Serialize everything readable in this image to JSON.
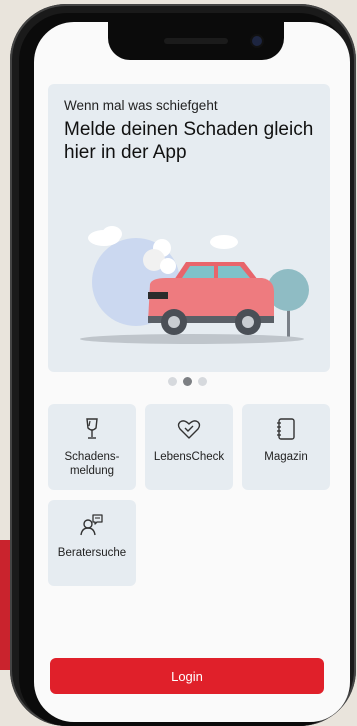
{
  "hero": {
    "kicker": "Wenn mal was schiefgeht",
    "title": "Melde deinen Schaden gleich hier in der App"
  },
  "carousel": {
    "count": 3,
    "active": 1
  },
  "tiles": [
    {
      "label": "Schadens-\nmeldung",
      "icon": "glass-icon"
    },
    {
      "label": "LebensCheck",
      "icon": "heart-check-icon"
    },
    {
      "label": "Magazin",
      "icon": "notebook-icon"
    },
    {
      "label": "Beratersuche",
      "icon": "advisor-chat-icon"
    }
  ],
  "login": {
    "label": "Login"
  },
  "colors": {
    "accent": "#e0202a",
    "tile_bg": "#e6ecf1",
    "car": "#ee7b7f"
  }
}
